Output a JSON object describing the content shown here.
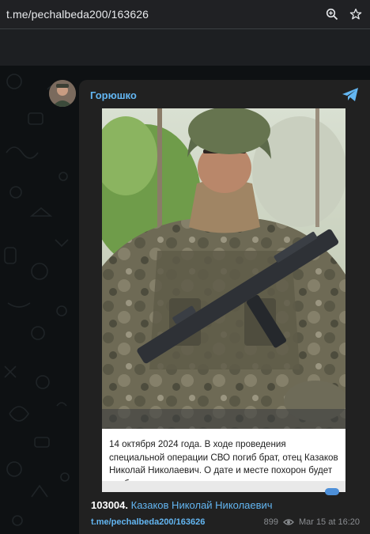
{
  "browser": {
    "url": "t.me/pechalbeda200/163626",
    "icons": [
      "zoom-icon",
      "star-icon"
    ]
  },
  "post": {
    "channel_name": "Горюшко",
    "caption": "14 октября 2024 года. В ходе проведения специальной операции СВО погиб брат, отец Казаков Николай Николаевич. О дате и месте похорон будет сообщено позже.",
    "title_number": "103004.",
    "title_text": "Казаков Николай Николаевич",
    "link": "t.me/pechalbeda200/163626",
    "views": "899",
    "date": "Mar 15 at 16:20"
  },
  "colors": {
    "accent": "#63b6f2",
    "card": "#212121",
    "background": "#0e1113"
  }
}
